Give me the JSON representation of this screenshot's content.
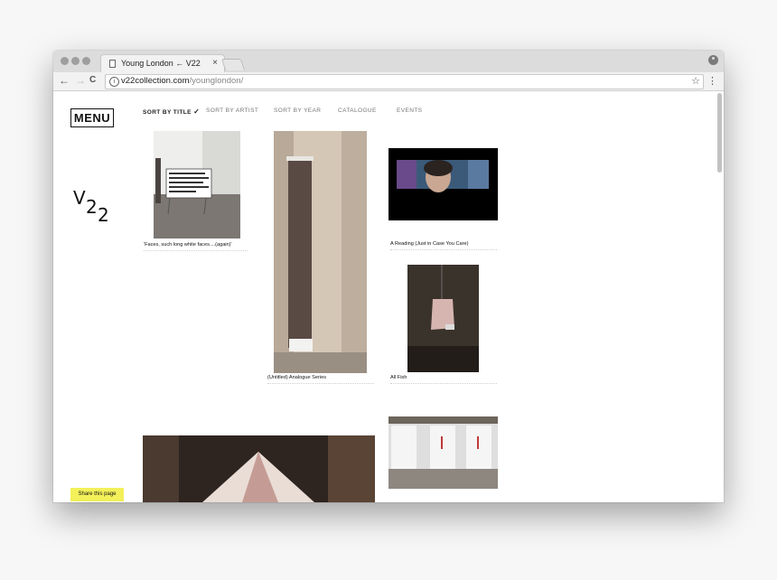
{
  "browser": {
    "tab_title": "Young London ← V22",
    "tab_close": "×",
    "back": "←",
    "forward": "→",
    "reload": "C",
    "info": "i",
    "url_domain": "v22collection.com",
    "url_path": "/younglondon/",
    "star": "☆",
    "menu": "⋮"
  },
  "site": {
    "menu_label": "MENU",
    "logo": {
      "v": "V",
      "two_a": "2",
      "two_b": "2"
    },
    "nav": [
      {
        "label": "SORT BY TITLE",
        "active": true
      },
      {
        "label": "SORT BY ARTIST"
      },
      {
        "label": "SORT BY YEAR"
      },
      {
        "label": "CATALOGUE"
      },
      {
        "label": "EVENTS"
      }
    ],
    "nav_check": "✓",
    "share_label": "Share this page"
  },
  "artworks": [
    {
      "caption": "'Faces, such long white faces....(again)'"
    },
    {
      "caption": "(Untitled) Analogue Series"
    },
    {
      "caption": "A Reading (Just in Case You Care)"
    },
    {
      "caption": "All Fish"
    },
    {
      "caption": ""
    },
    {
      "caption": ""
    }
  ],
  "colors": {
    "share_bg": "#f3f05a",
    "titlebar": "#dcdcdc",
    "page_bg": "#ffffff"
  }
}
